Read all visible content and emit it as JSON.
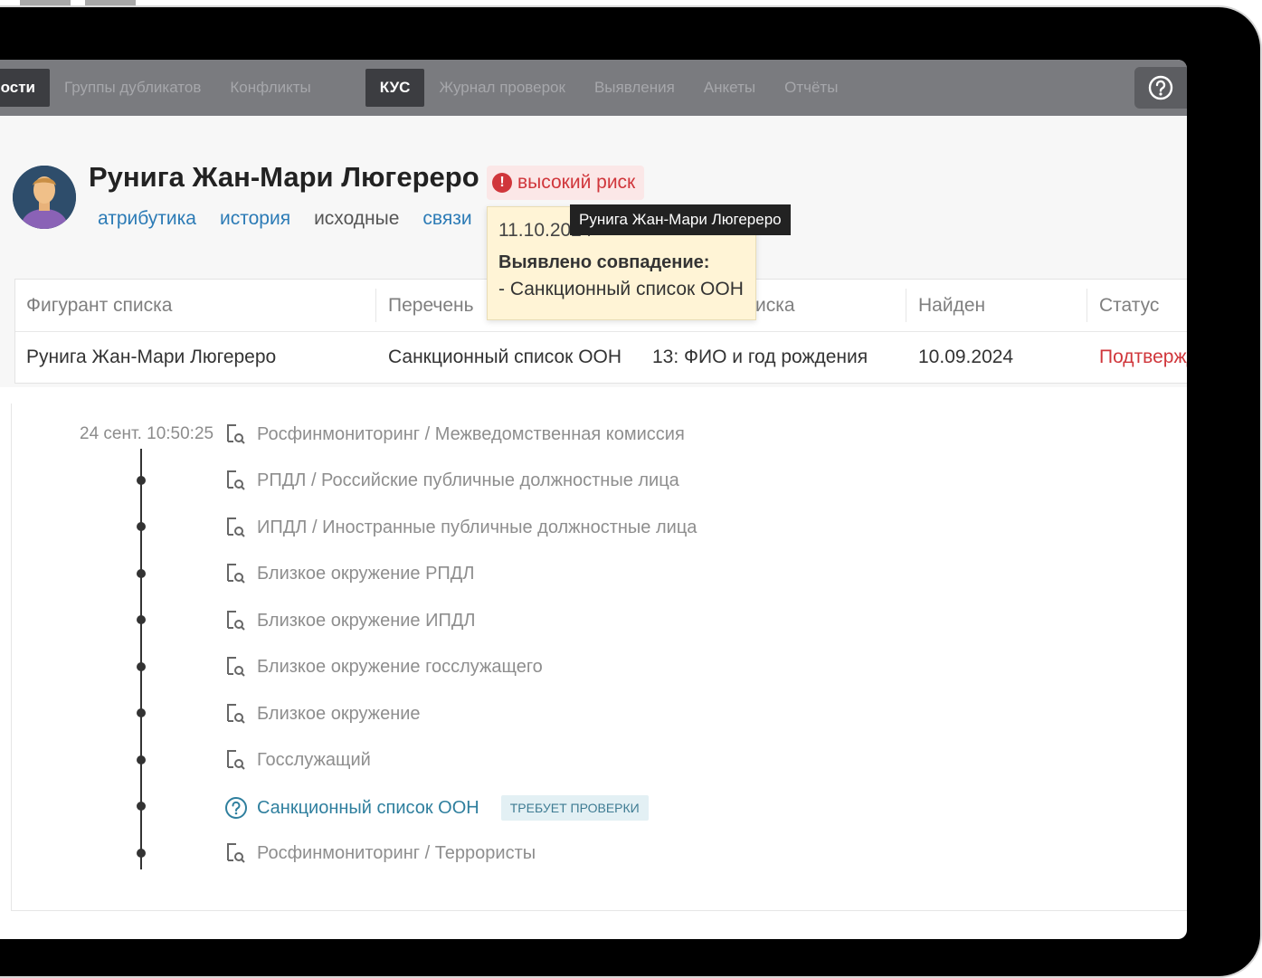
{
  "nav": {
    "items": [
      {
        "label": "щности",
        "style": "dark"
      },
      {
        "label": "Группы дубликатов",
        "style": "muted"
      },
      {
        "label": "Конфликты",
        "style": "muted"
      },
      {
        "label": "КУС",
        "style": "dark",
        "gap_before": true
      },
      {
        "label": "Журнал проверок",
        "style": "muted"
      },
      {
        "label": "Выявления",
        "style": "muted"
      },
      {
        "label": "Анкеты",
        "style": "muted"
      },
      {
        "label": "Отчёты",
        "style": "muted"
      }
    ]
  },
  "person": {
    "name": "Рунига Жан-Мари Люгереро",
    "risk": "высокий риск",
    "tabs": [
      {
        "label": "атрибутика",
        "style": "link"
      },
      {
        "label": "история",
        "style": "link"
      },
      {
        "label": "исходные",
        "style": "plain"
      },
      {
        "label": "связи",
        "style": "link"
      }
    ]
  },
  "table": {
    "headers": [
      "Фигурант списка",
      "Перечень",
      "иска",
      "Найден",
      "Статус"
    ],
    "rows": [
      [
        "Рунига Жан-Мари Люгереро",
        "Санкционный список ООН",
        "13: ФИО и год рождения",
        "10.09.2024",
        "Подтверждено"
      ]
    ]
  },
  "popup": {
    "date": "11.10.2024",
    "title": "Выявлено совпадение:",
    "line": "- Санкционный список ООН"
  },
  "tooltip": {
    "text": "Рунига Жан-Мари Люгереро"
  },
  "history": {
    "timestamp": "24 сент. 10:50:25",
    "items": [
      {
        "label": "Росфинмониторинг / Межведомственная комиссия",
        "icon": "document-search-icon"
      },
      {
        "label": "РПДЛ / Российские публичные должностные лица",
        "icon": "document-search-icon"
      },
      {
        "label": "ИПДЛ / Иностранные публичные должностные лица",
        "icon": "document-search-icon"
      },
      {
        "label": "Близкое окружение РПДЛ",
        "icon": "document-search-icon"
      },
      {
        "label": "Близкое окружение ИПДЛ",
        "icon": "document-search-icon"
      },
      {
        "label": "Близкое окружение госслужащего",
        "icon": "document-search-icon"
      },
      {
        "label": "Близкое окружение",
        "icon": "document-search-icon"
      },
      {
        "label": "Госслужащий",
        "icon": "document-search-icon"
      },
      {
        "label": "Санкционный список ООН",
        "icon": "question-circle-icon",
        "badge": "ТРЕБУЕТ ПРОВЕРКИ",
        "active": true
      },
      {
        "label": "Росфинмониторинг / Террористы",
        "icon": "document-search-icon"
      }
    ]
  },
  "colors": {
    "accent": "#2c7bb6",
    "risk": "#d0363b",
    "nav_bg": "#7a7b7f",
    "nav_active": "#3c3d41",
    "popup_bg": "#fff4d6"
  }
}
